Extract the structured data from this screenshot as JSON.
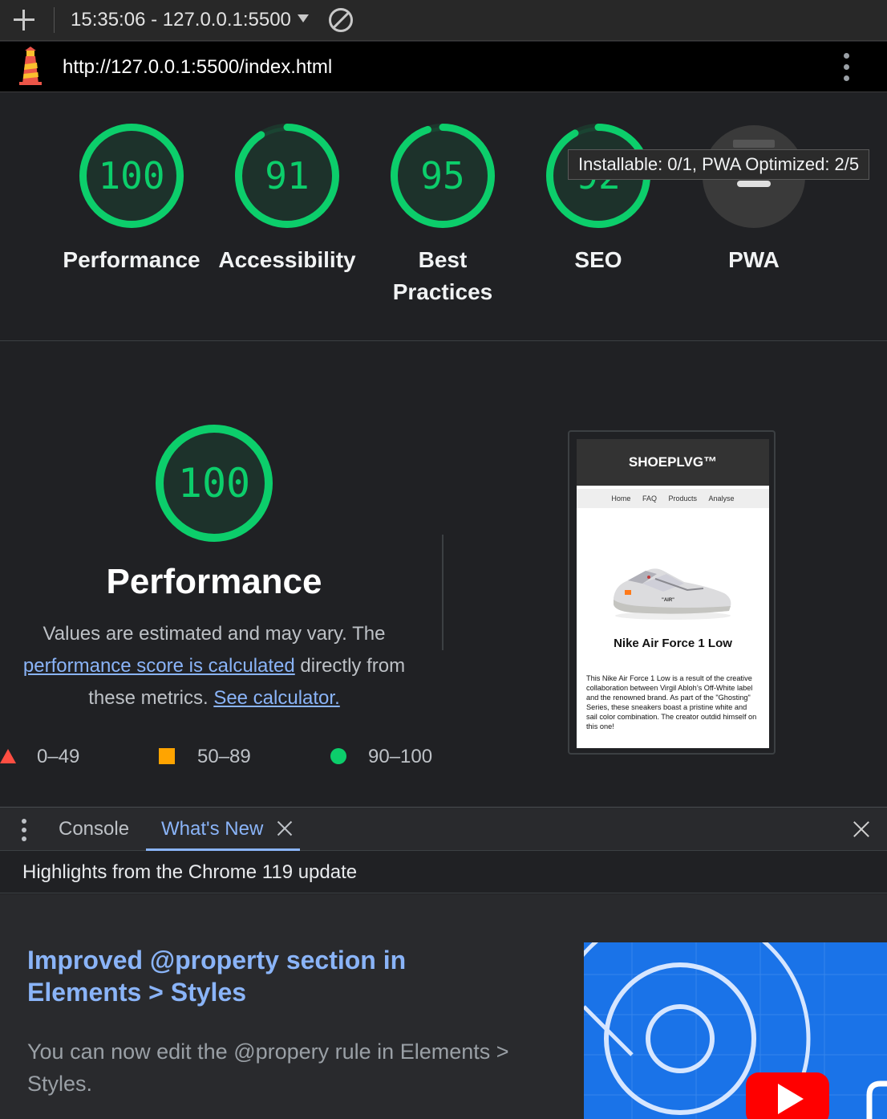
{
  "topbar": {
    "session": "15:35:06 - 127.0.0.1:5500"
  },
  "urlbar": {
    "url": "http://127.0.0.1:5500/index.html"
  },
  "categories": [
    {
      "label": "Performance",
      "score": "100",
      "value": 100
    },
    {
      "label": "Accessibility",
      "score": "91",
      "value": 91
    },
    {
      "label": "Best Practices",
      "score": "95",
      "value": 95
    },
    {
      "label": "SEO",
      "score": "92",
      "value": 92
    },
    {
      "label": "PWA",
      "score": "",
      "value": null
    }
  ],
  "tooltip": "Installable: 0/1, PWA Optimized: 2/5",
  "performance": {
    "score": "100",
    "value": 100,
    "title": "Performance",
    "desc_part1": "Values are estimated and may vary. The",
    "desc_link1": "performance score is calculated",
    "desc_part2": "directly from these metrics.",
    "desc_link2": "See calculator."
  },
  "legend": {
    "fail": "0–49",
    "average": "50–89",
    "pass": "90–100"
  },
  "screenshot": {
    "brand": "SHOEPLVG™",
    "nav": [
      "Home",
      "FAQ",
      "Products",
      "Analyse"
    ],
    "shoe_label": "\"AIR\"",
    "product_name": "Nike Air Force 1 Low",
    "product_desc": "This Nike Air Force 1 Low is a result of the creative collaboration between Virgil Abloh’s Off-White label and the renowned brand. As part of the \"Ghosting\" Series, these sneakers boast a pristine white and sail color combination. The creator outdid himself on this one!"
  },
  "drawer": {
    "tabs": [
      "Console",
      "What's New"
    ],
    "active_tab": "What's New",
    "highlights": "Highlights from the Chrome 119 update",
    "feature_title": "Improved @property section in Elements > Styles",
    "feature_desc": "You can now edit the @propery rule in Elements > Styles."
  },
  "colors": {
    "pass": "#0cce6b",
    "average": "#ffa400",
    "fail": "#ff4e42",
    "link": "#8ab4f8",
    "background": "#202124"
  },
  "icons": [
    "plus-icon",
    "dropdown-caret-icon",
    "clear-block-icon",
    "lighthouse-logo-icon",
    "more-vert-icon",
    "close-icon",
    "play-icon"
  ]
}
